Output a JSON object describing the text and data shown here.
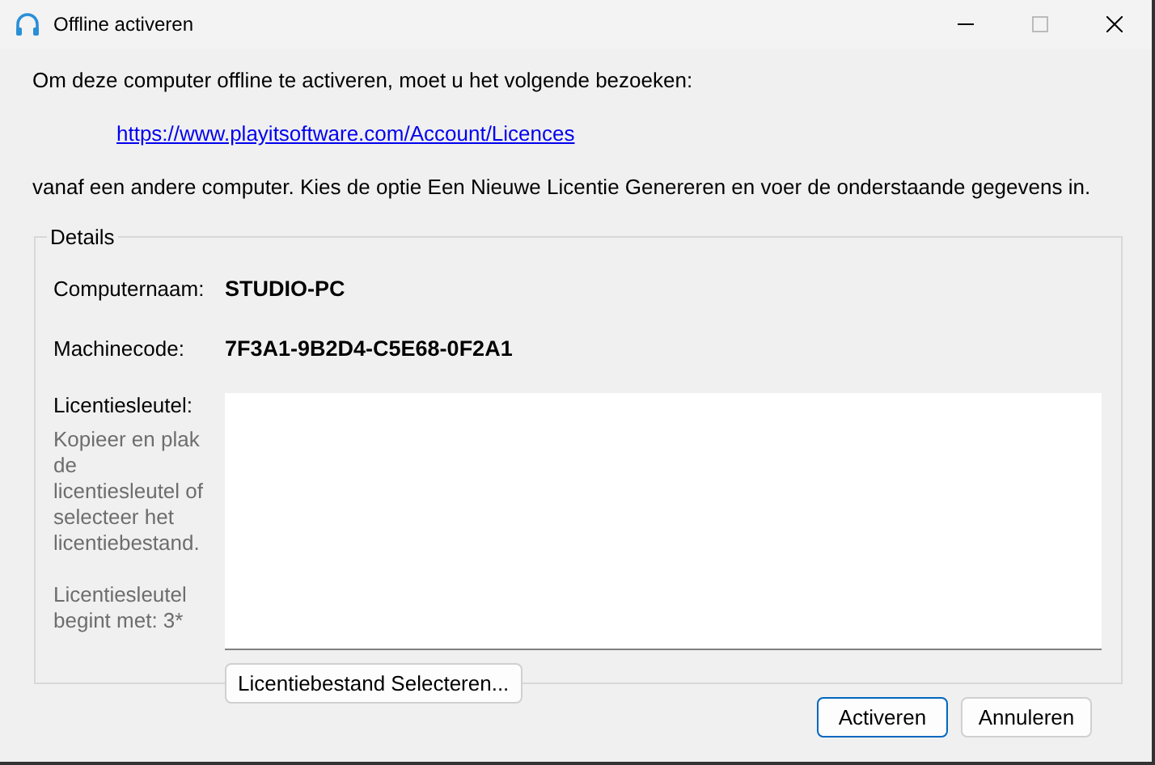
{
  "window": {
    "title": "Offline activeren"
  },
  "intro": "Om deze computer offline te activeren, moet u het volgende bezoeken:",
  "link": "https://www.playitsoftware.com/Account/Licences",
  "instructions": "vanaf een andere computer. Kies de optie Een Nieuwe Licentie Genereren en voer de onderstaande gegevens in.",
  "details": {
    "title": "Details",
    "fields": [
      {
        "label": "Computernaam:",
        "value": "STUDIO-PC"
      },
      {
        "label": "Machinecode:",
        "value": "7F3A1-9B2D4-C5E68-0F2A1"
      }
    ],
    "license_label": "Licentiesleutel:",
    "license_hint": "Kopieer en plak de licentiesleutel of selecteer het licentiebestand.",
    "license_prefix_hint": "Licentiesleutel begint met: 3*",
    "select_button": "Licentiebestand Selecteren..."
  },
  "buttons": [
    {
      "label": "Activeren",
      "selected": true
    },
    {
      "label": "Annuleren",
      "selected": false
    }
  ]
}
